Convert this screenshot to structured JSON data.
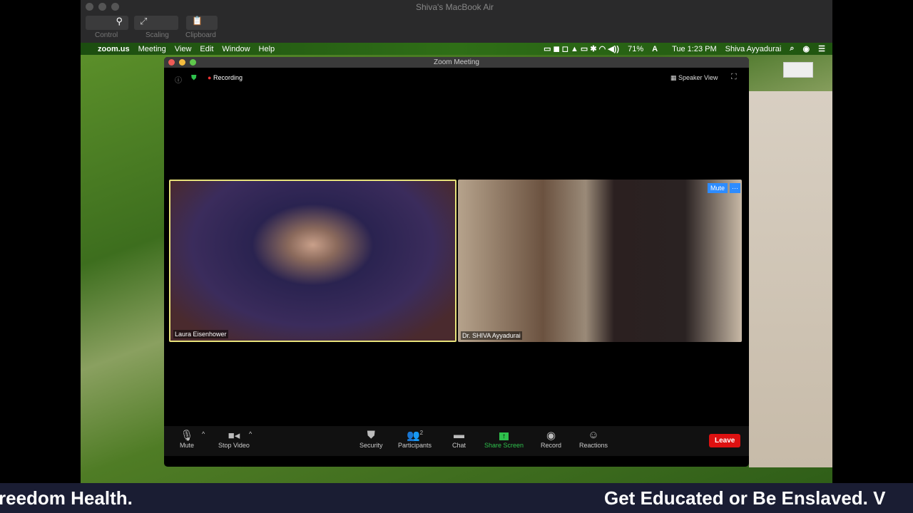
{
  "remote": {
    "title": "Shiva's MacBook Air",
    "control": "Control",
    "scaling": "Scaling",
    "clipboard": "Clipboard"
  },
  "menubar": {
    "app": "zoom.us",
    "items": [
      "Meeting",
      "View",
      "Edit",
      "Window",
      "Help"
    ],
    "battery": "71%",
    "clock": "Tue 1:23 PM",
    "user": "Shiva Ayyadurai"
  },
  "zoom": {
    "window_title": "Zoom Meeting",
    "recording": "Recording",
    "speaker_view": "Speaker View",
    "participants": [
      {
        "name": "Laura Eisenhower"
      },
      {
        "name": "Dr. SHIVA Ayyadurai",
        "mute_label": "Mute",
        "more": "···"
      }
    ],
    "toolbar": {
      "mute": "Mute",
      "stop_video": "Stop Video",
      "security": "Security",
      "participants": "Participants",
      "participant_count": "2",
      "chat": "Chat",
      "share_screen": "Share Screen",
      "record": "Record",
      "reactions": "Reactions",
      "leave": "Leave"
    }
  },
  "ticker": {
    "left": "reedom Health.",
    "right": "Get Educated or Be Enslaved. V"
  }
}
